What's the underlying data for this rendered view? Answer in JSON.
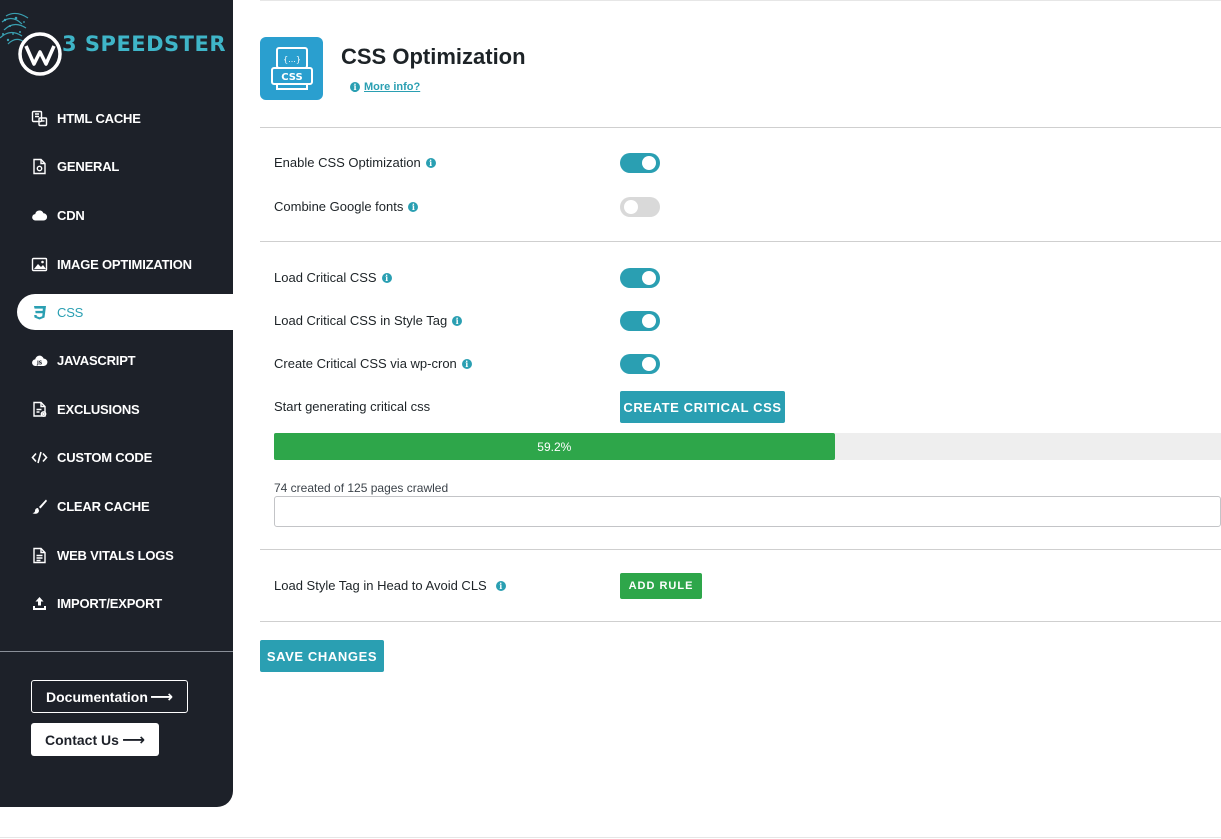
{
  "sidebar": {
    "brand": "3 SPEEDSTER",
    "items": [
      {
        "label": "HTML CACHE",
        "icon": "html-cache-icon",
        "active": false
      },
      {
        "label": "GENERAL",
        "icon": "general-file-icon",
        "active": false
      },
      {
        "label": "CDN",
        "icon": "cloud-icon",
        "active": false
      },
      {
        "label": "IMAGE OPTIMIZATION",
        "icon": "image-icon",
        "active": false
      },
      {
        "label": "CSS",
        "icon": "css3-icon",
        "active": true
      },
      {
        "label": "JAVASCRIPT",
        "icon": "javascript-cloud-icon",
        "active": false
      },
      {
        "label": "EXCLUSIONS",
        "icon": "exclusions-file-icon",
        "active": false
      },
      {
        "label": "CUSTOM CODE",
        "icon": "code-icon",
        "active": false
      },
      {
        "label": "CLEAR CACHE",
        "icon": "brush-icon",
        "active": false
      },
      {
        "label": "WEB VITALS LOGS",
        "icon": "document-icon",
        "active": false
      },
      {
        "label": "IMPORT/EXPORT",
        "icon": "upload-icon",
        "active": false
      }
    ],
    "documentation_label": "Documentation",
    "contact_label": "Contact Us",
    "arrow": "⟶"
  },
  "header": {
    "icon_text": "CSS",
    "icon_braces": "{...}",
    "title": "CSS Optimization",
    "more_info": "More info?"
  },
  "settings": {
    "enable_css": {
      "label": "Enable CSS Optimization",
      "on": true
    },
    "combine_fonts": {
      "label": "Combine Google fonts",
      "on": false
    },
    "load_critical": {
      "label": "Load Critical CSS",
      "on": true
    },
    "critical_style_tag": {
      "label": "Load Critical CSS in Style Tag",
      "on": true
    },
    "critical_wpcron": {
      "label": "Create Critical CSS via wp-cron",
      "on": true
    },
    "start_generating": {
      "label": "Start generating critical css"
    },
    "style_tag_head": {
      "label": "Load Style Tag in Head to Avoid CLS"
    }
  },
  "buttons": {
    "create_critical": "CREATE CRITICAL CSS",
    "add_rule": "ADD RULE",
    "save_changes": "SAVE CHANGES"
  },
  "progress": {
    "percent": 59.2,
    "label": "59.2%",
    "crawl_status": "74 created of 125 pages crawled"
  },
  "colors": {
    "accent": "#2a9fb2",
    "sidebar_bg": "#1d2129",
    "success": "#2ea64a",
    "toggle_off": "#d9d9d9"
  }
}
